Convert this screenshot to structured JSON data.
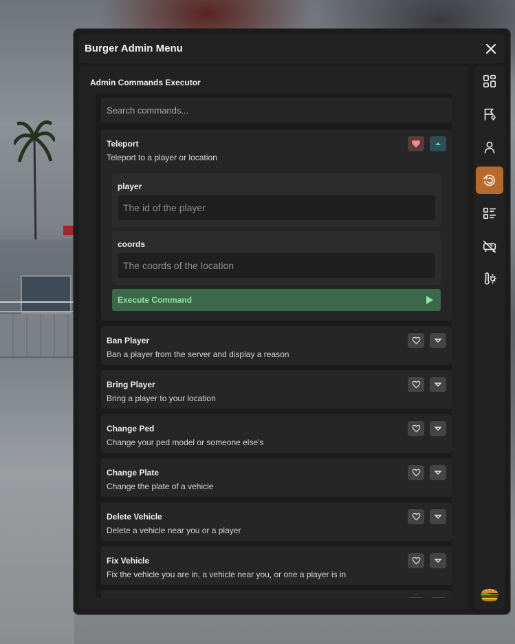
{
  "window": {
    "title": "Burger Admin Menu"
  },
  "content": {
    "section_title": "Admin Commands Executor",
    "search_placeholder": "Search commands..."
  },
  "expanded_command": {
    "name": "Teleport",
    "description": "Teleport to a player or location",
    "favorited": true,
    "params": [
      {
        "label": "player",
        "placeholder": "The id of the player"
      },
      {
        "label": "coords",
        "placeholder": "The coords of the location"
      }
    ],
    "execute_label": "Execute Command"
  },
  "commands": [
    {
      "name": "Ban Player",
      "description": "Ban a player from the server and display a reason"
    },
    {
      "name": "Bring Player",
      "description": "Bring a player to your location"
    },
    {
      "name": "Change Ped",
      "description": "Change your ped model or someone else's"
    },
    {
      "name": "Change Plate",
      "description": "Change the plate of a vehicle"
    },
    {
      "name": "Delete Vehicle",
      "description": "Delete a vehicle near you or a player"
    },
    {
      "name": "Fix Vehicle",
      "description": "Fix the vehicle you are in, a vehicle near you, or one a player is in"
    },
    {
      "name": "",
      "description": ""
    }
  ],
  "sidebar": {
    "items": [
      {
        "icon": "dashboard-icon",
        "active": false
      },
      {
        "icon": "flag-location-icon",
        "active": false
      },
      {
        "icon": "user-icon",
        "active": false
      },
      {
        "icon": "commands-icon",
        "active": true
      },
      {
        "icon": "list-icon",
        "active": false
      },
      {
        "icon": "vehicle-off-icon",
        "active": false
      },
      {
        "icon": "weather-icon",
        "active": false
      }
    ],
    "logo": "burger-icon"
  },
  "colors": {
    "panel": "#222222",
    "accent": "#b86a2c",
    "execute": "#3a6849",
    "execute_text": "#8fe3a3",
    "favorite_heart": "#f28b8b",
    "toggle_arrow": "#5fd3e0"
  }
}
